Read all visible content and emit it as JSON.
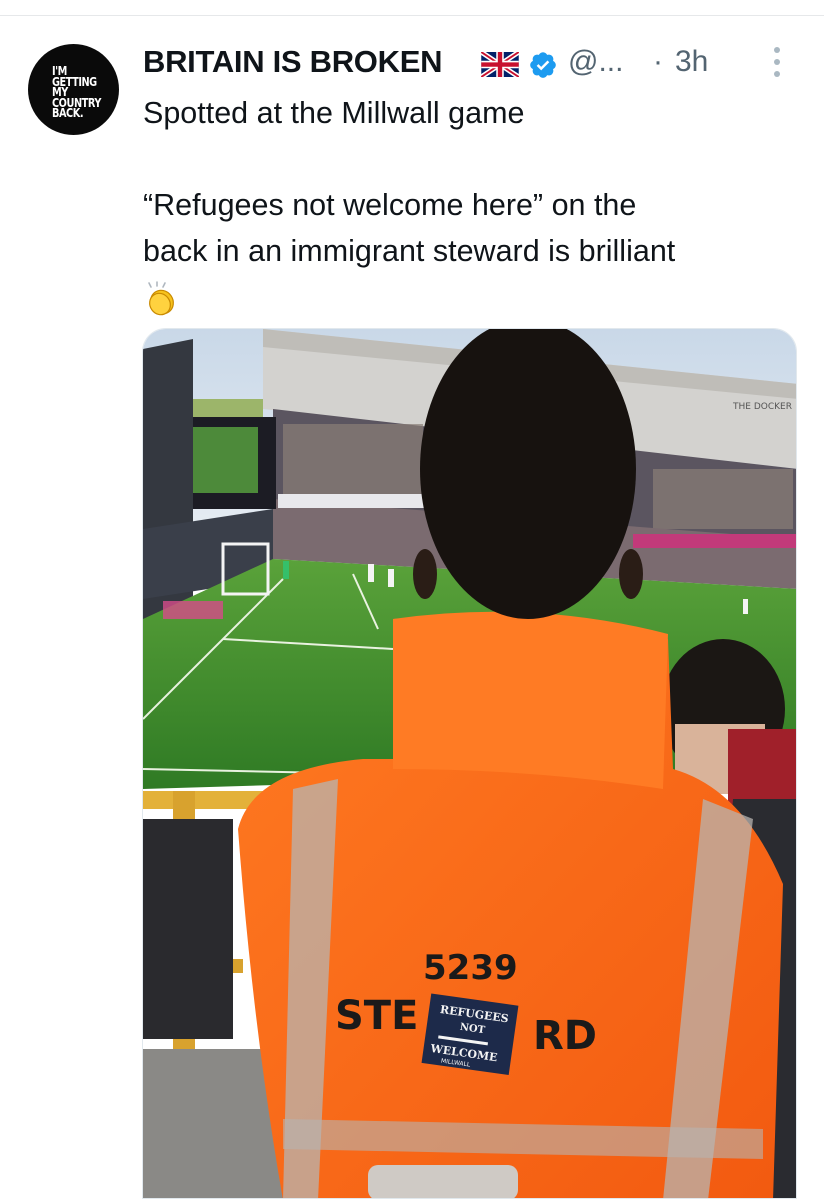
{
  "author": {
    "avatar_text": "I'M GETTING MY COUNTRY BACK.",
    "display_name": "BRITAIN IS BROKEN",
    "flag_icon": "uk-flag-icon",
    "verified_icon": "verified-badge-icon",
    "handle": "@...",
    "separator": "·",
    "time": "3h"
  },
  "tweet": {
    "line1": "Spotted at the Millwall game",
    "line2": "“Refugees not welcome here” on the",
    "line3": "back in an immigrant steward is brilliant",
    "emoji": "clapping-hands-icon"
  },
  "photo": {
    "stand_banner": "THE DOCKER",
    "jacket_number": "5239",
    "jacket_word_left": "STE",
    "jacket_word_right": "RD",
    "sticker_top": "REFUGEES",
    "sticker_mid": "NOT",
    "sticker_bottom": "WELCOME",
    "sticker_small": "MILLWALL"
  },
  "colors": {
    "verified": "#1d9bf0",
    "muted": "#536471",
    "jacket": "#ff6a1a",
    "pitch": "#3f8a2c"
  }
}
